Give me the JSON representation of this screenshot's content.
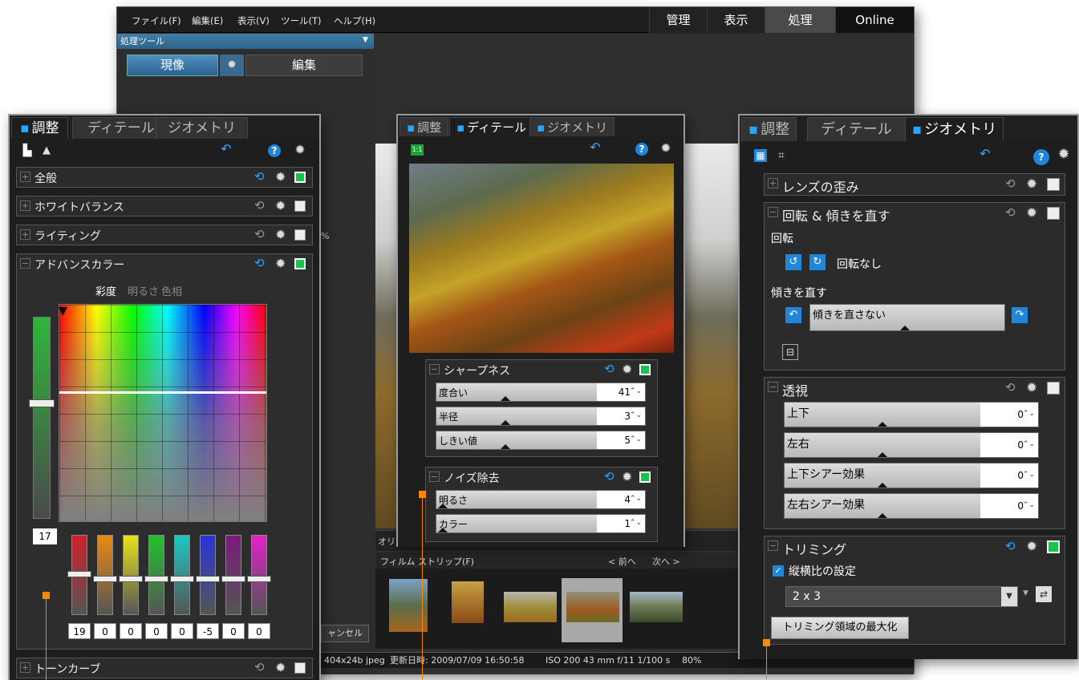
{
  "menu": {
    "items": [
      "ファイル(F)",
      "編集(E)",
      "表示(V)",
      "ツール(T)",
      "ヘルプ(H)"
    ],
    "modes": [
      "管理",
      "表示",
      "処理",
      "Online"
    ],
    "active_mode": "処理"
  },
  "tools_bar": {
    "title": "処理ツール",
    "develop_label": "現像",
    "edit_label": "編集"
  },
  "tabs": {
    "adjust": "調整",
    "detail": "ディテール",
    "geometry": "ジオメトリ"
  },
  "left_panel": {
    "sections": {
      "general": "全般",
      "white_balance": "ホワイトバランス",
      "lighting": "ライティング",
      "advanced_color": "アドバンスカラー",
      "tone_curve": "トーンカーブ"
    },
    "color_modes": [
      "彩度",
      "明るさ",
      "色相"
    ],
    "vertical_value": "17",
    "channel_values": [
      "19",
      "0",
      "0",
      "0",
      "0",
      "-5",
      "0",
      "0"
    ],
    "channel_colors": [
      "#d0202a",
      "#e88a12",
      "#e8e21c",
      "#22c12e",
      "#1cc8c4",
      "#2b34d8",
      "#7a1a7e",
      "#e420c8"
    ]
  },
  "middle_panel": {
    "sharpness_title": "シャープネス",
    "sharpness_rows": [
      {
        "label": "度合い",
        "value": "41"
      },
      {
        "label": "半径",
        "value": "3"
      },
      {
        "label": "しきい値",
        "value": "5"
      }
    ],
    "noise_title": "ノイズ除去",
    "noise_rows": [
      {
        "label": "明るさ",
        "value": "4"
      },
      {
        "label": "カラー",
        "value": "1"
      }
    ],
    "zoom_badge": "1:1"
  },
  "right_panel": {
    "lens_title": "レンズの歪み",
    "rotate_title": "回転 & 傾きを直す",
    "rotate_label": "回転",
    "rotate_none": "回転なし",
    "straighten_label": "傾きを直す",
    "straighten_value": "傾きを直さない",
    "perspective_title": "透視",
    "perspective_rows": [
      {
        "label": "上下",
        "value": "0"
      },
      {
        "label": "左右",
        "value": "0"
      },
      {
        "label": "上下シアー効果",
        "value": "0"
      },
      {
        "label": "左右シアー効果",
        "value": "0"
      }
    ],
    "crop_title": "トリミング",
    "aspect_label": "縦横比の設定",
    "aspect_value": "2 x 3",
    "maximize_label": "トリミング領域の最大化"
  },
  "filmstrip": {
    "title": "フィルム ストリップ(F)",
    "prev": "< 前へ",
    "next": "次へ >"
  },
  "bg_fragments": {
    "cancel": "ャンセル",
    "percent": "%",
    "ori": "オリ"
  },
  "status": {
    "file": "404x24b jpeg",
    "modified": "更新日時: 2009/07/09 16:50:58",
    "exif": "ISO 200   43 mm   f/11   1/100 s",
    "zoom": "80%"
  },
  "colors": {
    "accent": "#29a6ff",
    "toggle_on": "#19c24a",
    "callout": "#ff8800"
  }
}
